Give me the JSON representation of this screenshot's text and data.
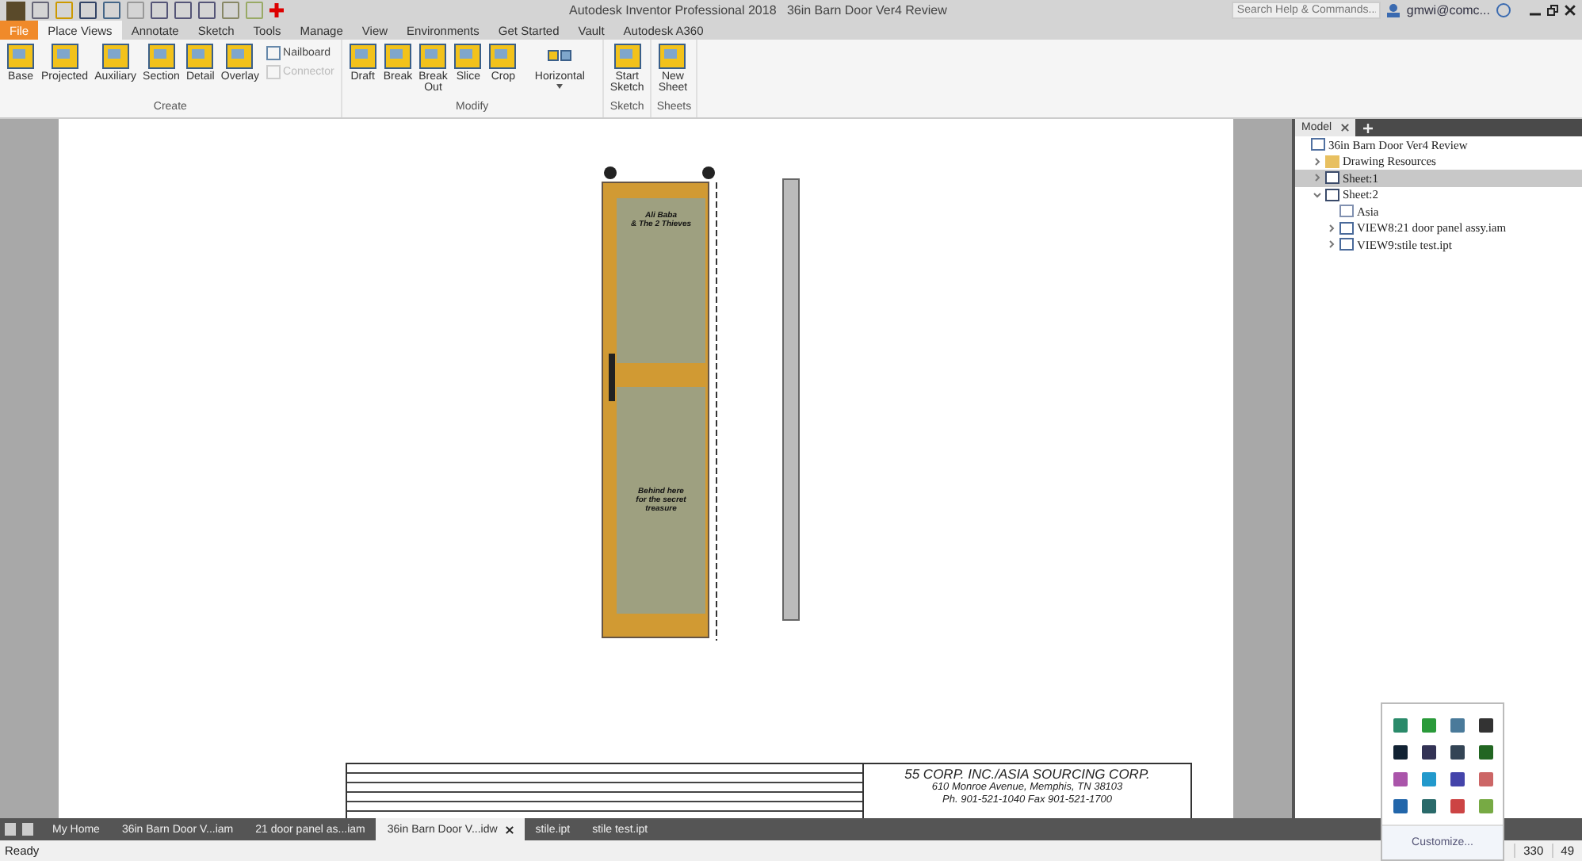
{
  "window": {
    "title": "Autodesk Inventor Professional 2018",
    "document": "36in Barn Door Ver4 Review"
  },
  "search": {
    "placeholder": "Search Help & Commands..."
  },
  "user": {
    "name": "gmwi@comc..."
  },
  "ribbon_tabs": [
    {
      "label": "File",
      "kind": "file"
    },
    {
      "label": "Place Views",
      "kind": "tab",
      "selected": true
    },
    {
      "label": "Annotate",
      "kind": "tab",
      "selected": false
    },
    {
      "label": "Sketch",
      "kind": "tab",
      "selected": false
    },
    {
      "label": "Tools",
      "kind": "tab",
      "selected": false
    },
    {
      "label": "Manage",
      "kind": "tab",
      "selected": false
    },
    {
      "label": "View",
      "kind": "tab",
      "selected": false
    },
    {
      "label": "Environments",
      "kind": "tab",
      "selected": false
    },
    {
      "label": "Get Started",
      "kind": "tab",
      "selected": false
    },
    {
      "label": "Vault",
      "kind": "tab",
      "selected": false
    },
    {
      "label": "Autodesk A360",
      "kind": "tab",
      "selected": false
    }
  ],
  "ribbon_groups": [
    {
      "label": "Create",
      "tools": [
        {
          "label": "Base",
          "kind": "large",
          "disabled": false
        },
        {
          "label": "Projected",
          "kind": "large",
          "disabled": false
        },
        {
          "label": "Auxiliary",
          "kind": "large",
          "disabled": false
        },
        {
          "label": "Section",
          "kind": "large",
          "disabled": false
        },
        {
          "label": "Detail",
          "kind": "large",
          "disabled": false
        },
        {
          "label": "Overlay",
          "kind": "large",
          "disabled": false
        },
        {
          "label": "Nailboard",
          "kind": "small",
          "disabled": false
        },
        {
          "label": "Connector",
          "kind": "small",
          "disabled": true
        }
      ]
    },
    {
      "label": "Modify",
      "tools": [
        {
          "label": "Draft",
          "kind": "large",
          "disabled": false
        },
        {
          "label": "Break",
          "kind": "large",
          "disabled": false
        },
        {
          "label": "Break Out",
          "kind": "large",
          "disabled": false
        },
        {
          "label": "Slice",
          "kind": "large",
          "disabled": false
        },
        {
          "label": "Crop",
          "kind": "large",
          "disabled": false
        },
        {
          "label": "Horizontal",
          "kind": "dropdown",
          "disabled": false
        }
      ]
    },
    {
      "label": "Sketch",
      "tools": [
        {
          "label": "Start Sketch",
          "kind": "large",
          "disabled": false
        }
      ]
    },
    {
      "label": "Sheets",
      "tools": [
        {
          "label": "New Sheet",
          "kind": "large",
          "disabled": false
        }
      ]
    }
  ],
  "browser": {
    "tab": "Model",
    "tree": [
      {
        "label": "36in Barn Door Ver4 Review",
        "kind": "document",
        "selected": false,
        "children": [
          {
            "label": "Drawing Resources",
            "kind": "folder",
            "expanded": false,
            "selected": false
          },
          {
            "label": "Sheet:1",
            "kind": "sheet",
            "expanded": false,
            "selected": true
          },
          {
            "label": "Sheet:2",
            "kind": "sheet",
            "expanded": true,
            "selected": false,
            "children": [
              {
                "label": "Asia",
                "kind": "border",
                "selected": false
              },
              {
                "label": "VIEW8:21 door panel assy.iam",
                "kind": "view",
                "expanded": false,
                "selected": false
              },
              {
                "label": "VIEW9:stile test.ipt",
                "kind": "view",
                "expanded": false,
                "selected": false
              }
            ]
          }
        ]
      }
    ]
  },
  "drawing": {
    "notes": [
      [
        "Ali Baba",
        "& The 2 Thieves"
      ],
      [
        "Behind here",
        "for the secret",
        "treasure"
      ]
    ]
  },
  "title_block": {
    "company": "55 CORP. INC./ASIA SOURCING CORP.",
    "address": "610 Monroe Avenue, Memphis, TN  38103",
    "phone": "Ph. 901-521-1040   Fax 901-521-1700"
  },
  "document_tabs": [
    {
      "label": "My Home",
      "selected": false
    },
    {
      "label": "36in Barn Door V...iam",
      "selected": false
    },
    {
      "label": "21 door panel as...iam",
      "selected": false
    },
    {
      "label": "36in Barn Door V...idw",
      "selected": true
    },
    {
      "label": "stile.ipt",
      "selected": false
    },
    {
      "label": "stile test.ipt",
      "selected": false
    }
  ],
  "tray": {
    "button": "Customize..."
  },
  "status_bar": {
    "text": "Ready",
    "readouts": [
      "330",
      "49"
    ]
  }
}
